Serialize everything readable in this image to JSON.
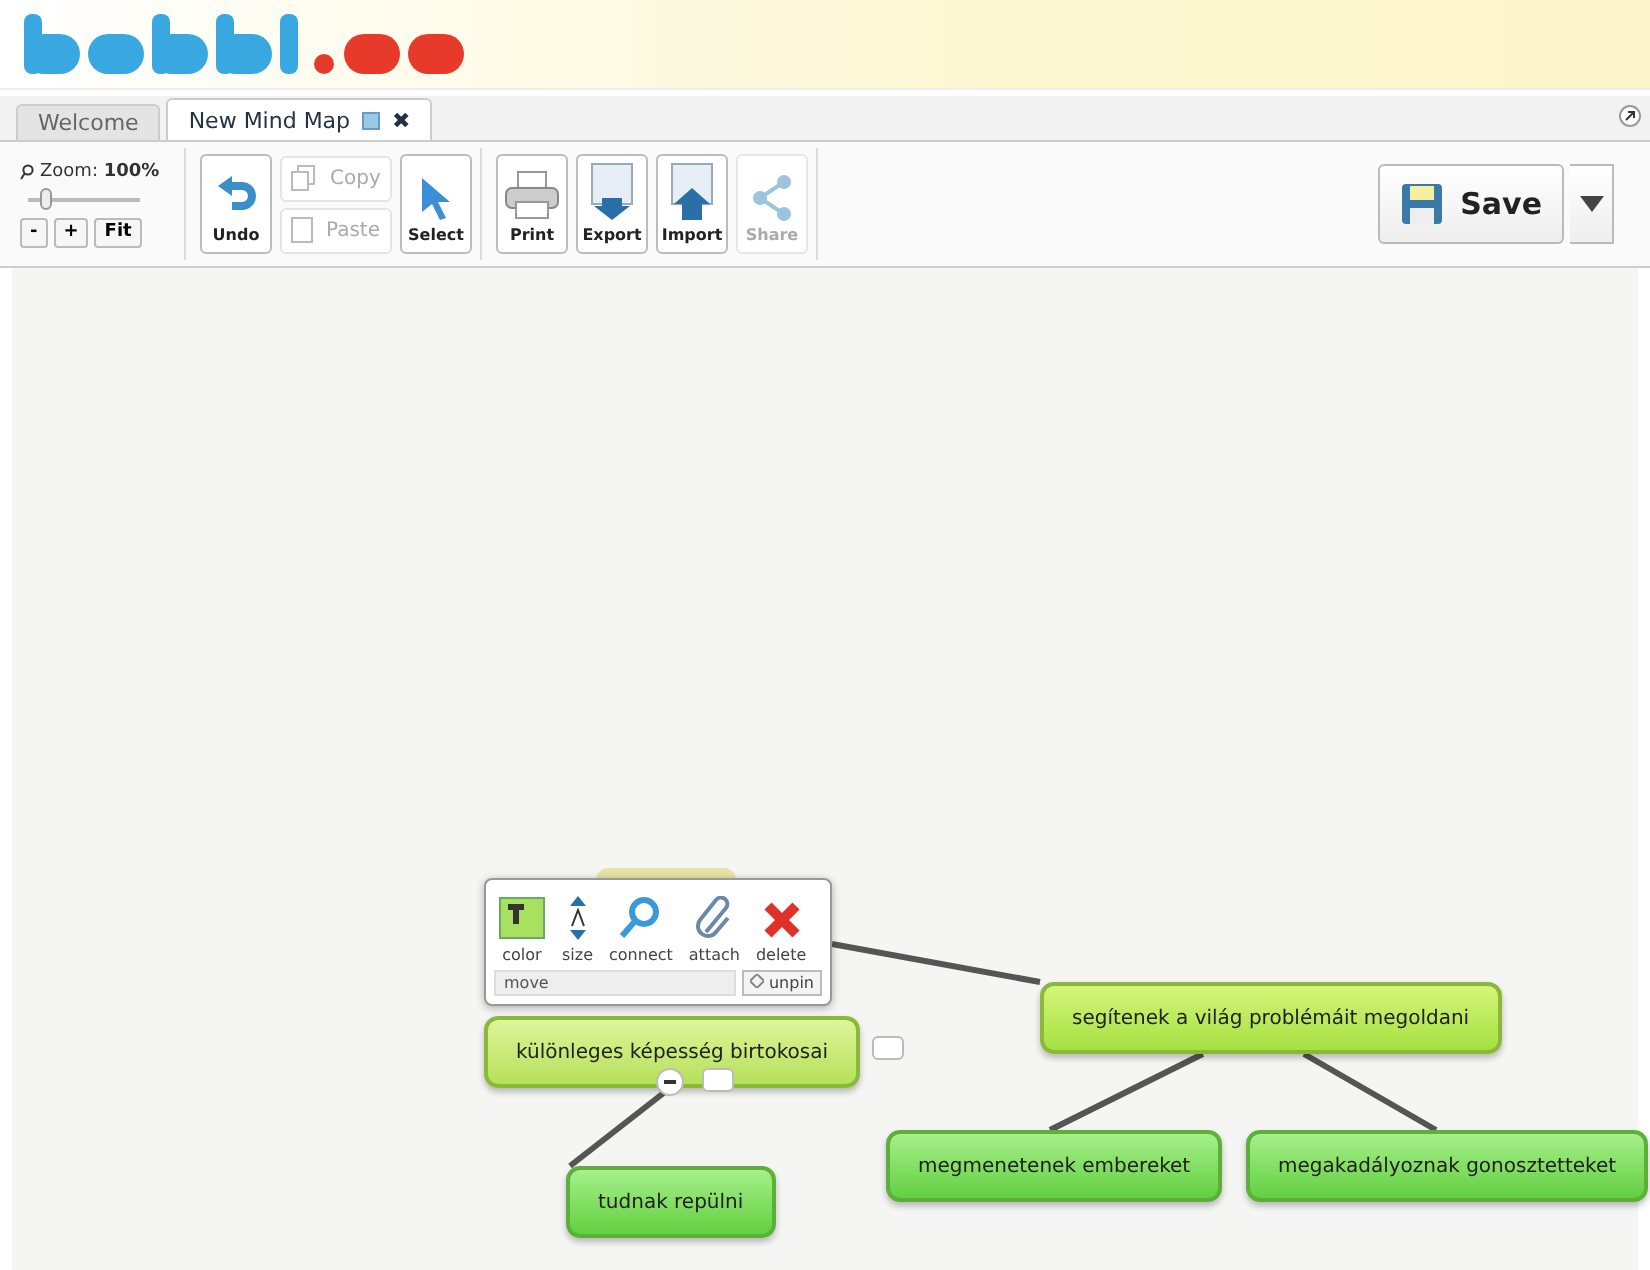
{
  "tabs": [
    {
      "label": "Welcome",
      "selected": false
    },
    {
      "label": "New Mind Map",
      "selected": true,
      "close": "✖"
    }
  ],
  "toolbar": {
    "zoom_label": "Zoom:",
    "zoom_value": "100%",
    "zoom": {
      "level": 0.1
    },
    "zoom_buttons": [
      "-",
      "+",
      "Fit"
    ],
    "tools": [
      {
        "label": "Undo",
        "kind": "undo",
        "disabled": false
      },
      {
        "label": "Copy",
        "kind": "copy",
        "disabled": true
      },
      {
        "label": "Paste",
        "kind": "paste",
        "disabled": true
      },
      {
        "label": "Select",
        "kind": "select",
        "disabled": false
      },
      {
        "label": "Print",
        "kind": "print",
        "disabled": false
      },
      {
        "label": "Export",
        "kind": "export",
        "disabled": false
      },
      {
        "label": "Import",
        "kind": "import",
        "disabled": false
      },
      {
        "label": "Share",
        "kind": "share",
        "disabled": true
      }
    ],
    "save": "Save"
  },
  "popup": {
    "tools": [
      {
        "label": "color",
        "kind": "color"
      },
      {
        "label": "size",
        "kind": "size"
      },
      {
        "label": "connect",
        "kind": "connect"
      },
      {
        "label": "attach",
        "kind": "attach"
      },
      {
        "label": "delete",
        "kind": "delete"
      }
    ],
    "move": "move",
    "unpin": "unpin"
  },
  "nodes": [
    {
      "text": "különleges képesség birtokosai",
      "selected": true,
      "children": [
        {
          "text": "tudnak repülni",
          "selected": false
        }
      ]
    },
    {
      "text": "segítenek a világ problémáit megoldani",
      "selected": false,
      "children": [
        {
          "text": "megmenetenek embereket",
          "selected": false
        },
        {
          "text": "megakadályoznak gonosztetteket",
          "selected": false
        }
      ]
    }
  ]
}
